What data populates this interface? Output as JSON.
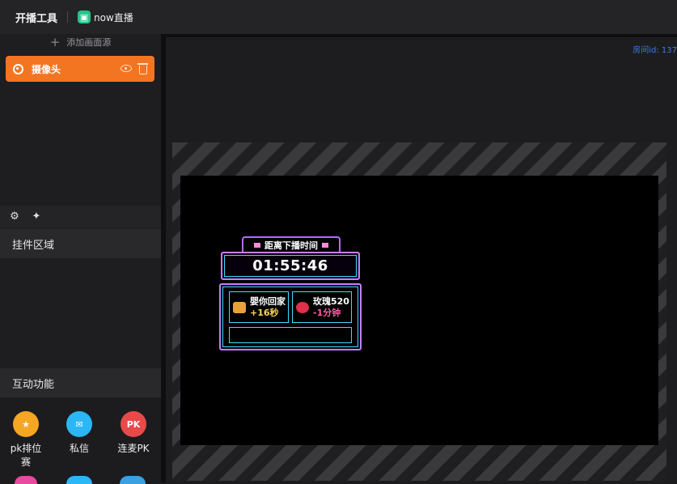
{
  "topbar": {
    "title": "开播工具",
    "brand": "now直播",
    "brand_logo_icon": "now-logo-icon"
  },
  "sidebar": {
    "add_source_label": "添加画面源",
    "source_item": {
      "label": "摄像头",
      "color": "#f47521"
    },
    "widget_area_label": "挂件区域",
    "interact_label": "互动功能",
    "features": [
      {
        "label": "pk排位赛",
        "icon": "trophy-icon",
        "color": "#f5a623"
      },
      {
        "label": "私信",
        "icon": "mail-icon",
        "color": "#2bb7f5"
      },
      {
        "label": "连麦PK",
        "icon": "pk-icon",
        "color": "#e84a4a"
      }
    ]
  },
  "preview": {
    "room_id": "房间id: 137",
    "widget": {
      "tab_title": "距离下播时间",
      "timer": "01:55:46",
      "gift_left": {
        "title": "婴你回家",
        "value": "+16秒",
        "value_color": "#ffd45a"
      },
      "gift_right": {
        "title": "玫瑰520",
        "value": "-1分钟",
        "value_color": "#ff5aa7"
      }
    }
  }
}
